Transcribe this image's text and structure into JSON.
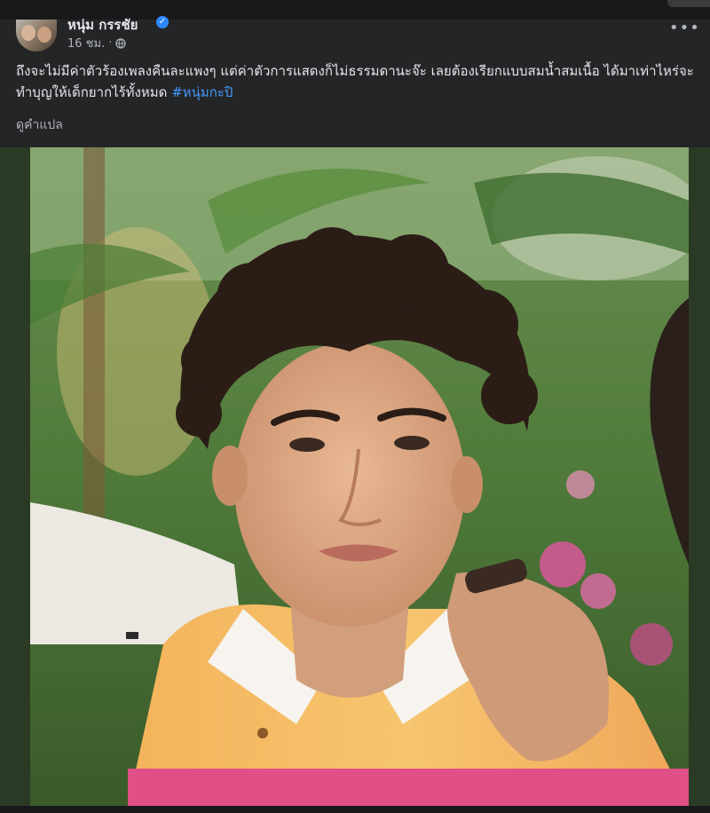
{
  "post": {
    "author_name": "หนุ่ม กรรชัย",
    "verified_icon": "verified-badge-icon",
    "time": "16 ชม.",
    "separator": "·",
    "privacy_icon": "globe-icon",
    "more_icon": "more-options-icon",
    "more_label": "•••",
    "text": "ถึงจะไม่มีค่าตัวร้องเพลงคืนละแพงๆ แต่ค่าตัวการแสดงก็ไม่ธรรมดานะจ๊ะ เลยต้องเรียกแบบสมน้ำสมเนื้อ ได้มาเท่าไหร่จะทำบุญให้เด็กยากไร้ทั้งหมด",
    "hashtag": "#หนุ่มกะปิ",
    "see_translation": "ดูคำแปล"
  },
  "photo": {
    "description_icon": "post-photo"
  },
  "colors": {
    "background": "#242526",
    "text": "#e4e6eb",
    "secondary_text": "#b0b3b8",
    "link": "#4599ff",
    "verified": "#2d88ff"
  }
}
